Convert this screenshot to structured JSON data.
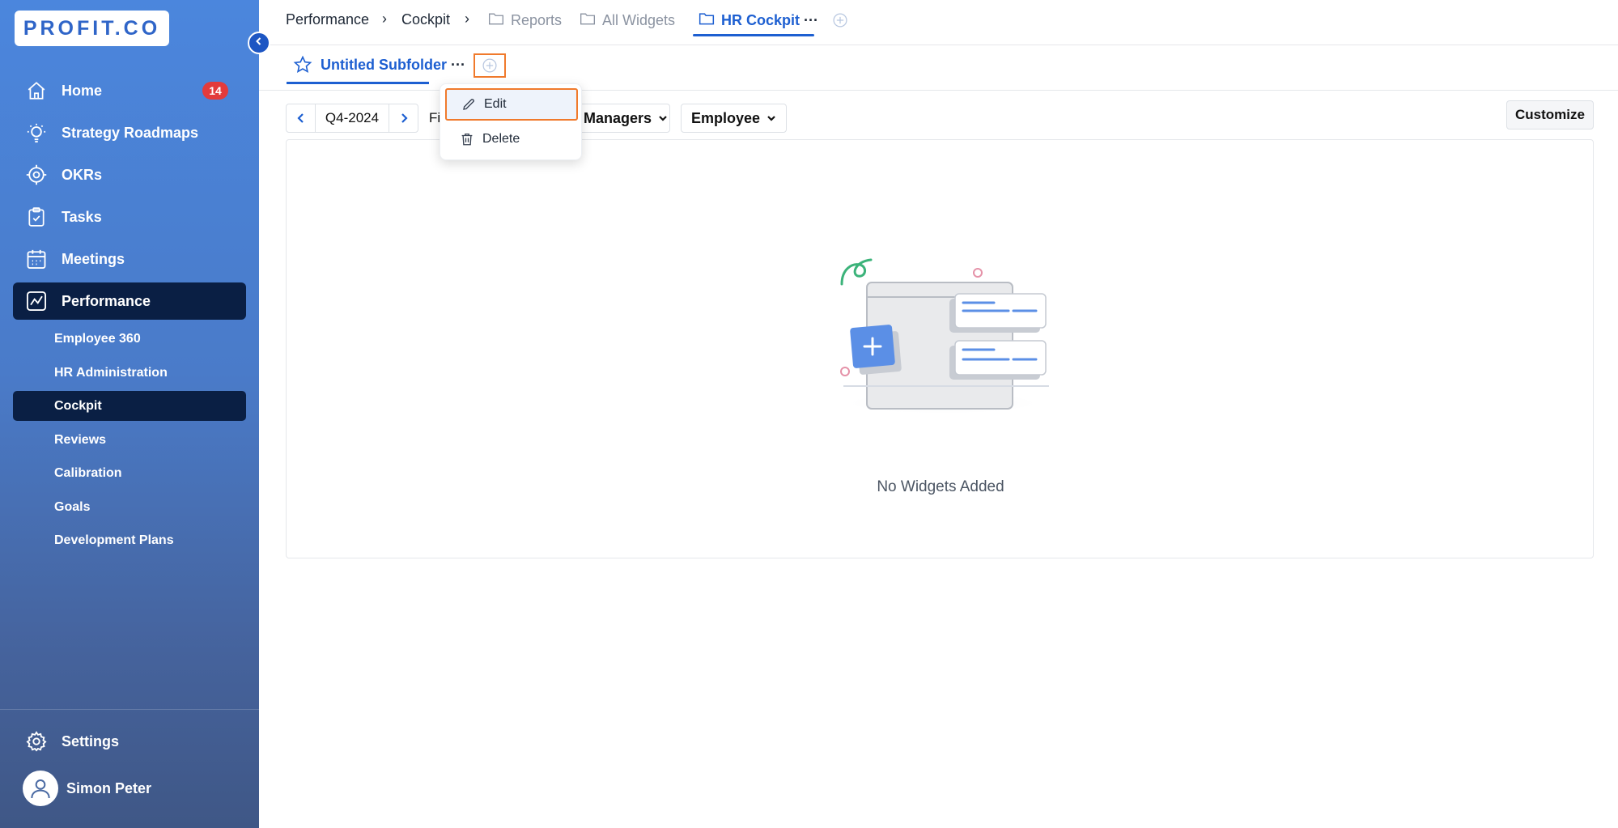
{
  "brand": {
    "logo": "PROFIT.CO"
  },
  "sidebar": {
    "items": [
      {
        "label": "Home",
        "icon": "home-icon",
        "badge": "14"
      },
      {
        "label": "Strategy Roadmaps",
        "icon": "bulb-icon"
      },
      {
        "label": "OKRs",
        "icon": "target-icon"
      },
      {
        "label": "Tasks",
        "icon": "clipboard-icon"
      },
      {
        "label": "Meetings",
        "icon": "calendar-icon"
      },
      {
        "label": "Performance",
        "icon": "chart-line-icon",
        "active": true
      }
    ],
    "sub_items": [
      {
        "label": "Employee 360"
      },
      {
        "label": "HR Administration"
      },
      {
        "label": "Cockpit",
        "active": true
      },
      {
        "label": "Reviews"
      },
      {
        "label": "Calibration"
      },
      {
        "label": "Goals"
      },
      {
        "label": "Development Plans"
      }
    ],
    "settings_label": "Settings",
    "user_name": "Simon Peter"
  },
  "breadcrumb": {
    "performance": "Performance",
    "cockpit": "Cockpit",
    "reports": "Reports",
    "all_widgets": "All Widgets",
    "hr_cockpit": "HR Cockpit",
    "more": "···"
  },
  "subfolder": {
    "tab_label": "Untitled Subfolder",
    "more": "···"
  },
  "menu": {
    "edit": "Edit",
    "delete": "Delete"
  },
  "filters": {
    "period": "Q4-2024",
    "fragment": "Fi",
    "managers": "Managers",
    "employee": "Employee",
    "customize": "Customize"
  },
  "content": {
    "empty_message": "No Widgets Added"
  },
  "colors": {
    "accent": "#1d5fd1",
    "highlight": "#f07a2c",
    "sidebar_active": "#0a1f44",
    "badge": "#e33b3b"
  }
}
